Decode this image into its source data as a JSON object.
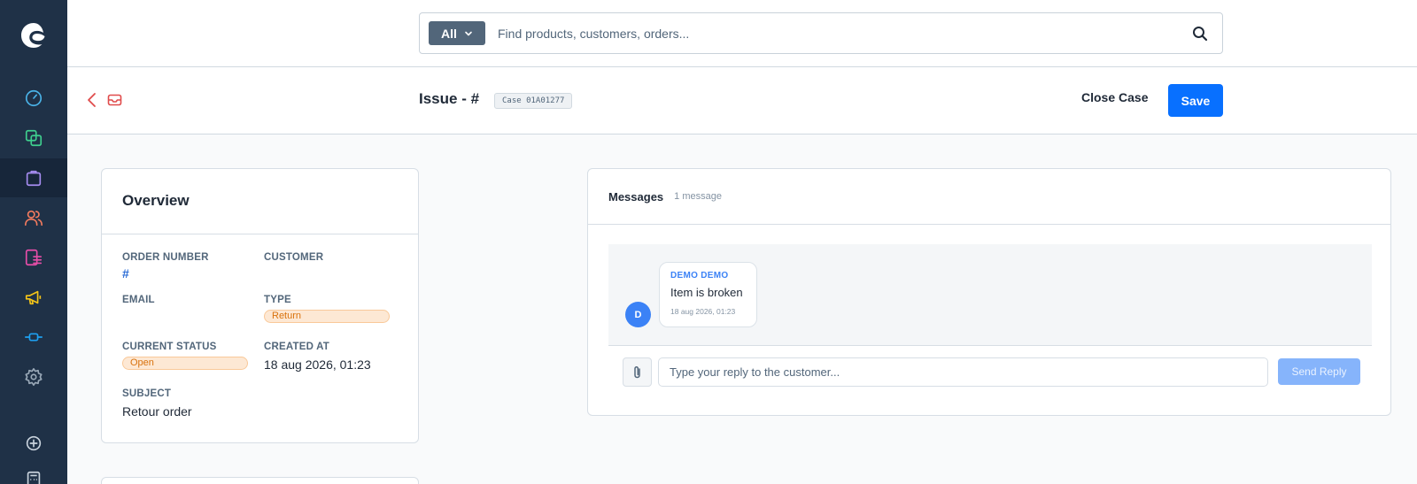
{
  "sidebar": {
    "logo": "shopware-logo",
    "items": [
      {
        "icon": "dashboard-icon",
        "color": "#4ab3e8"
      },
      {
        "icon": "catalog-icon",
        "color": "#3fcf8e"
      },
      {
        "icon": "orders-icon",
        "color": "#a58cf0",
        "active": true
      },
      {
        "icon": "customers-icon",
        "color": "#f47b5e"
      },
      {
        "icon": "content-icon",
        "color": "#e64ea8"
      },
      {
        "icon": "marketing-icon",
        "color": "#f5c518"
      },
      {
        "icon": "extensions-icon",
        "color": "#1ea0f0"
      },
      {
        "icon": "settings-icon",
        "color": "#9aa9b8"
      },
      {
        "icon": "add-icon",
        "color": "#c9d3dd"
      },
      {
        "icon": "calculator-icon",
        "color": "#c9d3dd"
      }
    ]
  },
  "search": {
    "scope_label": "All",
    "placeholder": "Find products, customers, orders..."
  },
  "header": {
    "title": "Issue - #",
    "case_label": "Case 01A01277",
    "close_label": "Close Case",
    "save_label": "Save"
  },
  "overview": {
    "title": "Overview",
    "order_number_label": "ORDER NUMBER",
    "order_number_value": "#",
    "customer_label": "CUSTOMER",
    "customer_value": "",
    "email_label": "EMAIL",
    "email_value": "",
    "type_label": "TYPE",
    "type_value": "Return",
    "status_label": "CURRENT STATUS",
    "status_value": "Open",
    "created_label": "CREATED AT",
    "created_value": "18 aug 2026, 01:23",
    "subject_label": "SUBJECT",
    "subject_value": "Retour order"
  },
  "messages": {
    "title": "Messages",
    "count": "1 message",
    "items": [
      {
        "avatar": "D",
        "author": "DEMO DEMO",
        "text": "Item is broken",
        "time": "18 aug 2026, 01:23"
      }
    ],
    "reply_placeholder": "Type your reply to the customer...",
    "send_label": "Send Reply"
  },
  "colors": {
    "sidebar_bg": "#1f3147",
    "primary": "#0870ff",
    "accent_red": "#e04b4b",
    "badge_orange": "#d9720d"
  }
}
